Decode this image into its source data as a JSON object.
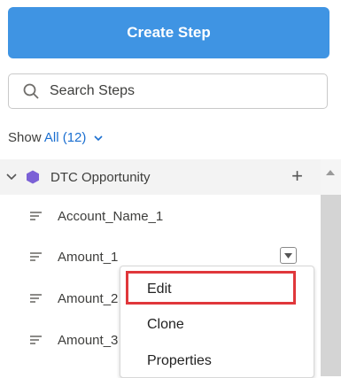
{
  "toolbar": {
    "create_label": "Create Step"
  },
  "search": {
    "placeholder": "Search Steps",
    "value": ""
  },
  "filter": {
    "prefix": "Show",
    "value": "All (12)"
  },
  "group": {
    "name": "DTC Opportunity",
    "expanded": true,
    "icon_color": "#7b61d6"
  },
  "steps": [
    {
      "label": "Account_Name_1"
    },
    {
      "label": "Amount_1"
    },
    {
      "label": "Amount_2"
    },
    {
      "label": "Amount_3"
    }
  ],
  "context_menu": {
    "items": [
      {
        "label": "Edit",
        "highlighted": true
      },
      {
        "label": "Clone"
      },
      {
        "label": "Properties"
      }
    ]
  },
  "colors": {
    "accent": "#3f94e3",
    "link": "#1b6fd0",
    "highlight": "#e0373b"
  }
}
